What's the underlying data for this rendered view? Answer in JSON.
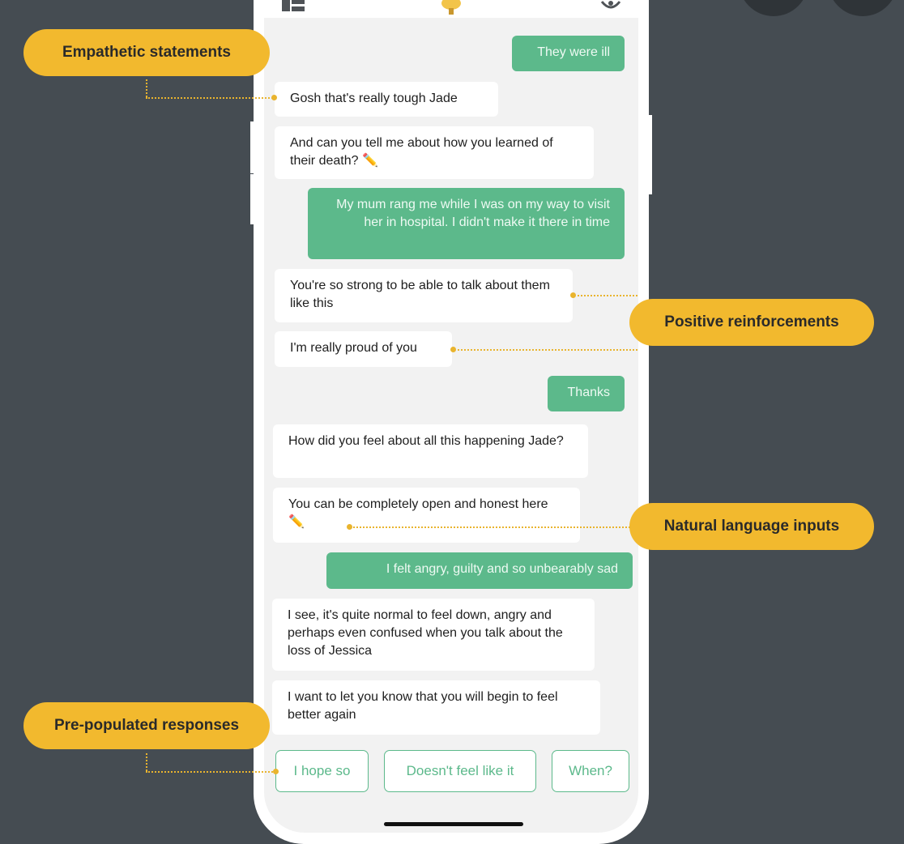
{
  "chat": {
    "messages": [
      {
        "from": "user",
        "text": "They were ill"
      },
      {
        "from": "bot",
        "text": "Gosh that's really tough Jade"
      },
      {
        "from": "bot",
        "text": "And can you tell me about how you learned of their death? ✏️"
      },
      {
        "from": "user",
        "text": "My mum rang me while I was on my way to visit her in hospital. I didn't make it there in time"
      },
      {
        "from": "bot",
        "text": "You're so strong to be able to talk about them like this"
      },
      {
        "from": "bot",
        "text": "I'm really proud of you"
      },
      {
        "from": "user",
        "text": "Thanks"
      },
      {
        "from": "bot",
        "text": "How did you feel about all this happening Jade?"
      },
      {
        "from": "bot",
        "text": "You can be completely open and honest here ✏️"
      },
      {
        "from": "user",
        "text": "I felt angry, guilty and so unbearably sad"
      },
      {
        "from": "bot",
        "text": "I see, it's quite normal to feel down, angry and perhaps even confused when you talk about the loss of Jessica"
      },
      {
        "from": "bot",
        "text": "I want to let you know that you will begin to feel better again"
      }
    ],
    "quick_replies": [
      "I hope so",
      "Doesn't feel like it",
      "When?"
    ]
  },
  "callouts": {
    "empathetic": "Empathetic statements",
    "positive": "Positive reinforcements",
    "natural": "Natural language inputs",
    "prepopulated": "Pre-populated responses"
  },
  "icons": {
    "left": "layout-icon",
    "center": "app-logo-icon",
    "right": "settings-icon"
  },
  "colors": {
    "background": "#454c52",
    "user_bubble": "#5cb98b",
    "callout": "#f2b92e",
    "accent_line": "#e9b42e"
  }
}
